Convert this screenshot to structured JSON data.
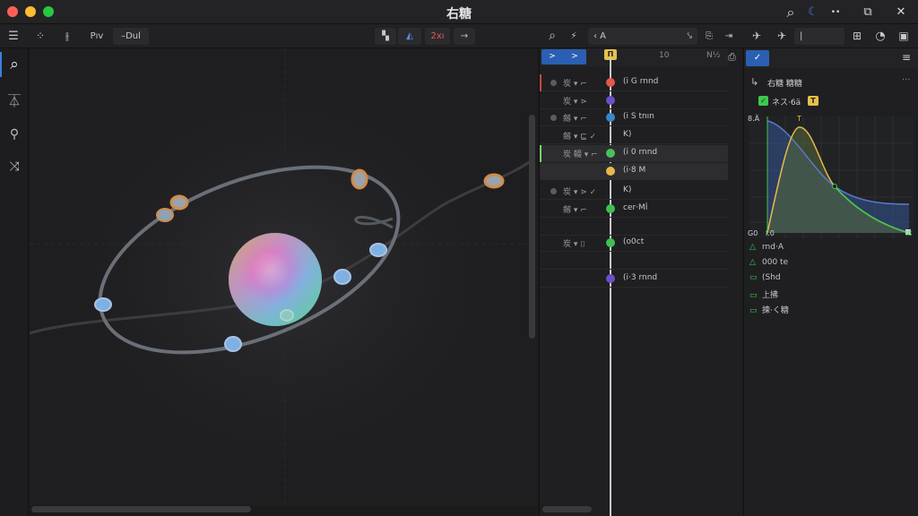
{
  "window": {
    "title": "右糖",
    "traffic_colors": [
      "#ff5f57",
      "#febc2e",
      "#28c840"
    ]
  },
  "titlebar_icons": {
    "search": "⌕",
    "globe": "☾",
    "more": "••",
    "panel": "⧉",
    "close": "✕"
  },
  "toolbar": {
    "menu_icon": "☰",
    "snap_icon": "⁘",
    "align_icon": "⫲",
    "mode_label": "Pıv",
    "duration_label": "–Dul",
    "view_btn_1": "▚",
    "view_btn_2": "◭",
    "zoom_label": "2xı",
    "arrows_label": "→",
    "tl_search_icon": "⌕",
    "tl_bolt_icon": "⚡",
    "tl_filter_text": "‹ A",
    "tl_filter_icon": "⤥",
    "tl_copy_icon": "⎘",
    "tl_split_icon": "⇥",
    "rt_icon_1": "✈",
    "rt_icon_2": "✈",
    "rt_icon_3": "|",
    "rt_icon_4": "⊞",
    "rt_icon_5": "◔",
    "rt_icon_6": "▣"
  },
  "left_tools": [
    {
      "name": "search-icon",
      "glyph": "⌕"
    },
    {
      "name": "stamp-icon",
      "glyph": "⏄"
    },
    {
      "name": "link-icon",
      "glyph": "⚲"
    },
    {
      "name": "transform-icon",
      "glyph": "⤨"
    }
  ],
  "accent_color": "#3d7ee0",
  "timeline": {
    "range_btn_1": ">",
    "range_btn_2": ">",
    "playhead_label": "П",
    "tick_10": "10",
    "tick_end": "N½",
    "corner_icon": "⎙",
    "rows": [
      {
        "pre": "炭 ▾ ⌐",
        "label": "(i G rnnd",
        "color": "#e05a47",
        "dot": true,
        "marker": "#c64a3a"
      },
      {
        "pre": "炭 ▾ ⋗",
        "label": "",
        "color": "#6a4fc7",
        "dot": false,
        "marker": ""
      },
      {
        "pre": "劔 ▾ ⌐",
        "label": "(i S tnın",
        "color": "#3a86c8",
        "dot": true,
        "marker": ""
      },
      {
        "pre": "劔 ▾ ⊑ ✓",
        "label": "K)",
        "color": "",
        "dot": false,
        "marker": ""
      },
      {
        "pre": "炭 輟 ▾ ⌐",
        "label": "(i 0 rnnd",
        "color": "#48c05a",
        "dot": false,
        "marker": "#7bd36a",
        "selected": true
      },
      {
        "pre": "",
        "label": "(i·8 M",
        "color": "#e8b84a",
        "dot": false,
        "marker": "",
        "selected": true
      },
      {
        "pre": "炭 ▾ ⋗ ✓",
        "label": "K)",
        "color": "",
        "dot": true,
        "marker": ""
      },
      {
        "pre": "劔 ▾ ⌐",
        "label": "cer·Mİ",
        "color": "#3fbf52",
        "dot": false,
        "marker": ""
      },
      {
        "pre": "",
        "label": "",
        "color": "",
        "dot": false,
        "marker": ""
      },
      {
        "pre": "炭 ▾ ⌷",
        "label": "(o0ct",
        "color": "#3fbf52",
        "dot": false,
        "marker": ""
      },
      {
        "pre": "",
        "label": "",
        "color": "",
        "dot": false,
        "marker": ""
      },
      {
        "pre": "",
        "label": "(i·3 rnnd",
        "color": "#6a4fc7",
        "dot": false,
        "marker": ""
      }
    ]
  },
  "inspector": {
    "tab_icon": "✓",
    "tab_menu": "≡",
    "back_icon": "↳",
    "header_label": "右糖 糖糖",
    "header_more": "···",
    "layer_badge": "✓",
    "layer_label": "ネス·6ä",
    "layer_flag": "T",
    "graph_top_left": "8.Ä",
    "graph_bottom_left": "G0",
    "graph_bottom_x": "l.0",
    "graph_peak_label": "T",
    "graph_end_label": "Iß",
    "properties": [
      {
        "icon": "△",
        "label": "rnd·A"
      },
      {
        "icon": "△",
        "label": "000 te"
      },
      {
        "icon": "▭",
        "label": "(Shd"
      },
      {
        "icon": "▭",
        "label": "上拂"
      },
      {
        "icon": "▭",
        "label": "揀·く糖"
      }
    ]
  }
}
